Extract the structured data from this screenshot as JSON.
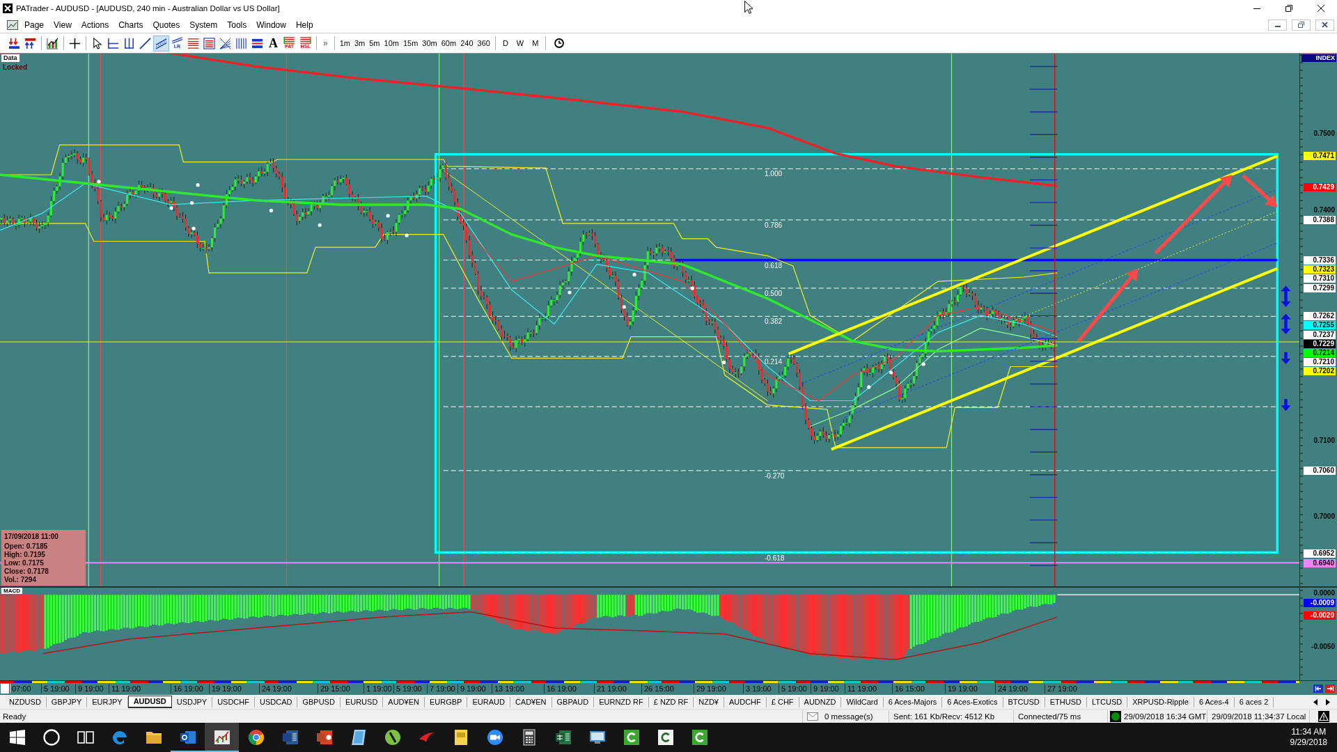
{
  "window": {
    "title": "PATrader - AUDUSD - [AUDUSD, 240 min - Australian Dollar vs US Dollar]"
  },
  "menu": {
    "items": [
      "Page",
      "View",
      "Actions",
      "Charts",
      "Quotes",
      "System",
      "Tools",
      "Window",
      "Help"
    ]
  },
  "toolbar": {
    "tools": [
      {
        "kind": "icon",
        "selected": false
      },
      {
        "kind": "icon",
        "selected": false
      },
      {
        "kind": "icon",
        "selected": false
      },
      {
        "kind": "icon",
        "selected": false
      },
      {
        "kind": "icon",
        "selected": false
      },
      {
        "kind": "icon",
        "selected": false
      },
      {
        "kind": "icon",
        "selected": false
      },
      {
        "kind": "icon",
        "selected": false
      },
      {
        "kind": "icon",
        "selected": true
      },
      {
        "kind": "badge",
        "label": "LR",
        "selected": false
      },
      {
        "kind": "icon",
        "selected": false
      },
      {
        "kind": "icon",
        "selected": false
      },
      {
        "kind": "icon",
        "selected": false
      },
      {
        "kind": "icon",
        "selected": false
      },
      {
        "kind": "icon",
        "selected": false
      },
      {
        "kind": "glyph",
        "label": "A",
        "selected": false
      },
      {
        "kind": "badge",
        "label": "PAT",
        "selected": false
      },
      {
        "kind": "badge",
        "label": "HSL",
        "selected": false
      }
    ],
    "overflow": "»",
    "timeframes": [
      "1m",
      "3m",
      "5m",
      "10m",
      "15m",
      "30m",
      "60m",
      "240",
      "360"
    ],
    "periods": [
      "D",
      "W",
      "M"
    ]
  },
  "chart": {
    "data_label": "Data",
    "lock_status": "Locked",
    "fib_levels": [
      "1.000",
      "0.786",
      "0.618",
      "0.500",
      "0.382",
      "0.214",
      "-0.270",
      "-0.618"
    ],
    "ohlc_box": {
      "date": "17/09/2018 11:00",
      "lines": [
        "Open: 0.7185",
        "High: 0.7195",
        "Low: 0.7175",
        "Close: 0.7178",
        "Vol.: 7294"
      ]
    }
  },
  "price_axis": {
    "index_label": "INDEX",
    "ticks": [
      "0.7500",
      "0.7400",
      "0.7100",
      "0.7000"
    ],
    "tags": [
      {
        "text": "0.7471",
        "color": "#ffff00"
      },
      {
        "text": "0.7429",
        "color": "#ff0000"
      },
      {
        "text": "0.7388",
        "color": "#ffffff"
      },
      {
        "text": "0.7336",
        "color": "#ffffff"
      },
      {
        "text": "0.7323",
        "color": "#ffff00"
      },
      {
        "text": "0.7310",
        "color": "#ffffff"
      },
      {
        "text": "0.7299",
        "color": "#ffffff"
      },
      {
        "text": "0.7262",
        "color": "#ffffff"
      },
      {
        "text": "0.7255",
        "color": "#00ffff"
      },
      {
        "text": "0.7237",
        "color": "#ffffff"
      },
      {
        "text": "0.7229",
        "color": "#000000"
      },
      {
        "text": "0.7214",
        "color": "#00ff00"
      },
      {
        "text": "0.7210",
        "color": "#ffffff"
      },
      {
        "text": "0.7202",
        "color": "#ffff00"
      },
      {
        "text": "0.7060",
        "color": "#ffffff"
      },
      {
        "text": "0.6952",
        "color": "#ffffff"
      },
      {
        "text": "0.6940",
        "color": "#ff80ff"
      }
    ]
  },
  "macd": {
    "label": "MACD",
    "ticks": [
      "0.0000",
      "-0.0050"
    ],
    "tags": [
      {
        "text": "-0.0009",
        "color": "#0000ff"
      },
      {
        "text": "-0.0020",
        "color": "#ff0000"
      }
    ]
  },
  "x_axis": {
    "labels": [
      "07:00",
      "5 19:00",
      "9 19:00",
      "11 19:00",
      "16 19:00",
      "19 19:00",
      "24 19:00",
      "29 15:00",
      "1 19:00",
      "5 19:00",
      "7 19:00",
      "9 19:00",
      "13 19:00",
      "16 19:00",
      "21 19:00",
      "26 15:00",
      "29 19:00",
      "3 19:00",
      "5 19:00",
      "9 19:00",
      "11 19:00",
      "16 15:00",
      "19 19:00",
      "24 19:00",
      "27 19:00"
    ]
  },
  "tabs": [
    {
      "label": "NZDUSD",
      "selected": false
    },
    {
      "label": "GBPJPY",
      "selected": false
    },
    {
      "label": "EURJPY",
      "selected": false
    },
    {
      "label": "AUDUSD",
      "selected": true
    },
    {
      "label": "USDJPY",
      "selected": false
    },
    {
      "label": "USDCHF",
      "selected": false
    },
    {
      "label": "USDCAD",
      "selected": false
    },
    {
      "label": "GBPUSD",
      "selected": false
    },
    {
      "label": "EURUSD",
      "selected": false
    },
    {
      "label": "AUD¥EN",
      "selected": false
    },
    {
      "label": "EURGBP",
      "selected": false
    },
    {
      "label": "EURAUD",
      "selected": false
    },
    {
      "label": "CAD¥EN",
      "selected": false
    },
    {
      "label": "GBPAUD",
      "selected": false
    },
    {
      "label": "EURNZD RF",
      "selected": false
    },
    {
      "label": "£ NZD RF",
      "selected": false
    },
    {
      "label": "NZD¥",
      "selected": false
    },
    {
      "label": "AUDCHF",
      "selected": false
    },
    {
      "label": "£ CHF",
      "selected": false
    },
    {
      "label": "AUDNZD",
      "selected": false
    },
    {
      "label": "WildCard",
      "selected": false
    },
    {
      "label": "6 Aces-Majors",
      "selected": false
    },
    {
      "label": "6 Aces-Exotics",
      "selected": false
    },
    {
      "label": "BTCUSD",
      "selected": false
    },
    {
      "label": "ETHUSD",
      "selected": false
    },
    {
      "label": "LTCUSD",
      "selected": false
    },
    {
      "label": "XRPUSD-Ripple",
      "selected": false
    },
    {
      "label": "6 Aces-4",
      "selected": false
    },
    {
      "label": "6 aces 2",
      "selected": false
    }
  ],
  "status_bar": {
    "status": "Ready",
    "messages": "0 message(s)",
    "traffic": "Sent: 161 Kb/Recv: 4512 Kb",
    "connection": "Connected/75 ms",
    "gmt_time": "29/09/2018 16:34 GMT",
    "local_time": "29/09/2018 11:34:37 Local"
  },
  "taskbar": {
    "apps": [
      {
        "running": false,
        "selected": false
      },
      {
        "running": false,
        "selected": false
      },
      {
        "running": true,
        "selected": false
      },
      {
        "running": true,
        "selected": true
      },
      {
        "running": false,
        "selected": false
      },
      {
        "running": false,
        "selected": false
      },
      {
        "running": false,
        "selected": false
      },
      {
        "running": false,
        "selected": false
      },
      {
        "running": false,
        "selected": false
      },
      {
        "running": false,
        "selected": false
      },
      {
        "running": false,
        "selected": false
      },
      {
        "running": false,
        "selected": false
      },
      {
        "running": false,
        "selected": false
      },
      {
        "running": false,
        "selected": false
      },
      {
        "running": false,
        "selected": false
      },
      {
        "running": false,
        "selected": false
      },
      {
        "running": false,
        "selected": false
      },
      {
        "running": false,
        "selected": false
      }
    ],
    "time": "11:34 AM",
    "date": "9/29/2018"
  }
}
